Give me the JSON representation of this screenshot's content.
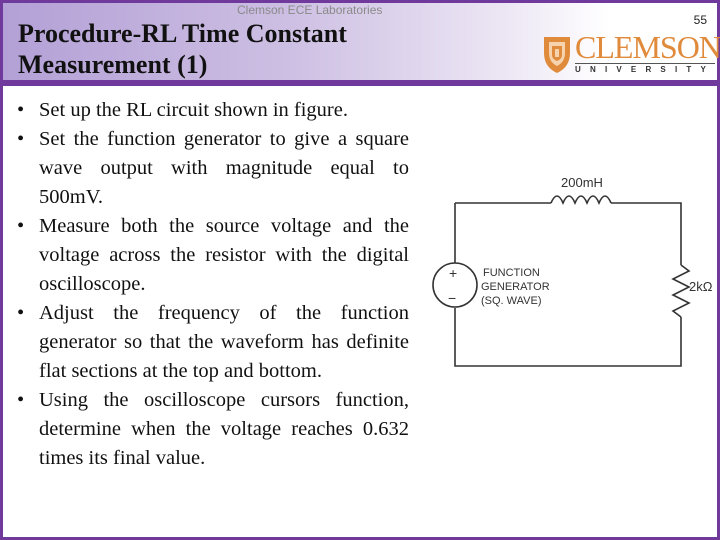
{
  "header": {
    "lab_name": "Clemson ECE Laboratories",
    "title_line1": "Procedure-RL Time Constant",
    "title_line2": "Measurement (1)",
    "page_number": "55",
    "logo": {
      "wordmark": "CLEMSON",
      "subtitle": "UNIVERSITY",
      "color": "#e08a3c"
    }
  },
  "theme": {
    "accent": "#6f3a9c"
  },
  "bullets": [
    {
      "text": "Set up the RL circuit shown in figure."
    },
    {
      "text": "Set the function generator to give a square wave output with magnitude equal to 500mV."
    },
    {
      "text": "Measure both the source voltage and the voltage across the resistor with the digital oscilloscope."
    },
    {
      "text": "Adjust the frequency of the function generator so that the waveform has definite flat sections at the top and bottom."
    },
    {
      "text": "Using the oscilloscope cursors function, determine when the voltage reaches 0.632 times its final value."
    }
  ],
  "bullet_glyph": "•",
  "circuit": {
    "inductor_label": "200mH",
    "resistor_label": "2kΩ",
    "source_label_1": "FUNCTION",
    "source_label_2": "GENERATOR",
    "source_label_3": "(SQ. WAVE)",
    "plus": "+",
    "minus": "−"
  }
}
